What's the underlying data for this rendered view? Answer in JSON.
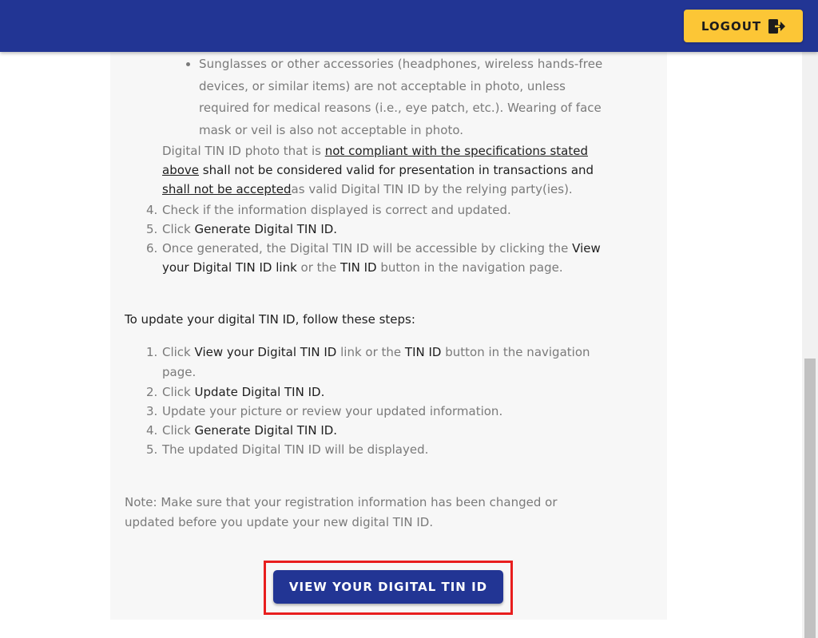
{
  "header": {
    "logout_label": "LOGOUT",
    "logout_icon": "logout-icon",
    "bar_color": "#223594",
    "button_color": "#fcc636"
  },
  "bullets": {
    "accessories_lines": [
      "Sunglasses or other accessories (headphones, wireless hands-free",
      "devices, or similar items) are not acceptable in photo, unless",
      "required for medical reasons (i.e., eye patch, etc.). Wearing of face",
      "mask or veil is also not acceptable in photo."
    ]
  },
  "compliance": {
    "l1_a": "Digital TIN ID photo that is ",
    "l1_b": "not compliant with the specifications stated",
    "l2_a": "above",
    "l2_b": " shall not be considered valid for presentation in transactions and",
    "l3_a": "shall not be accepted",
    "l3_b": "as valid Digital TIN ID by the relying party(ies)."
  },
  "generate_steps": {
    "s4_num": "4.",
    "s4_text": "Check if the information displayed is correct and updated.",
    "s5_num": "5.",
    "s5_a": "Click ",
    "s5_b": "Generate Digital TIN ID.",
    "s6_num": "6.",
    "s6_a": "Once generated, the Digital TIN ID will be accessible by clicking the ",
    "s6_b": "View",
    "s6_c": "your Digital TIN ID link",
    "s6_d": " or the ",
    "s6_e": "TIN ID",
    "s6_f": " button in the navigation page."
  },
  "update_section": {
    "heading": "To update your digital TIN ID, follow these steps:",
    "u1_num": "1.",
    "u1_a": "Click ",
    "u1_b": "View your Digital TIN ID",
    "u1_c": " link or the ",
    "u1_d": "TIN ID",
    "u1_e": " button in the navigation",
    "u1_f": "page.",
    "u2_num": "2.",
    "u2_a": "Click ",
    "u2_b": "Update Digital TIN ID.",
    "u3_num": "3.",
    "u3_text": "Update your picture or review your updated information.",
    "u4_num": "4.",
    "u4_a": "Click ",
    "u4_b": "Generate Digital TIN ID.",
    "u5_num": "5.",
    "u5_text": "The updated Digital TIN ID will be displayed."
  },
  "note": {
    "line1": "Note: Make sure that your registration information has been changed or",
    "line2": "updated before you update your new digital TIN ID."
  },
  "cta": {
    "view_label": "VIEW YOUR DIGITAL TIN ID",
    "highlight_color": "#e81e1e"
  }
}
